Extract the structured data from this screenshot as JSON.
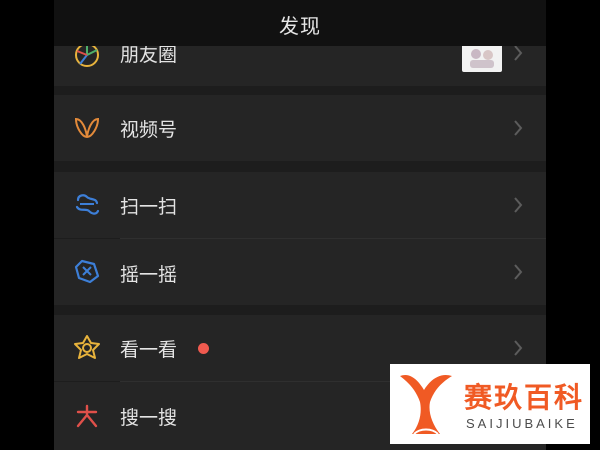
{
  "header": {
    "title": "发现"
  },
  "menu": {
    "moments": "朋友圈",
    "channels": "视频号",
    "scan": "扫一扫",
    "shake": "摇一摇",
    "top_stories": "看一看",
    "search": "搜一搜"
  },
  "watermark": {
    "name_cn": "赛玖百科",
    "name_en": "SAIJIUBAIKE"
  },
  "colors": {
    "background": "#1d1d1d",
    "row": "#252525",
    "badge_red": "#f05a4f",
    "scan_blue": "#3d7fd8",
    "channels_orange": "#e38a3a",
    "top_stories_yellow": "#e8b33c",
    "search_red": "#e0504a",
    "watermark_orange": "#f05a24"
  }
}
